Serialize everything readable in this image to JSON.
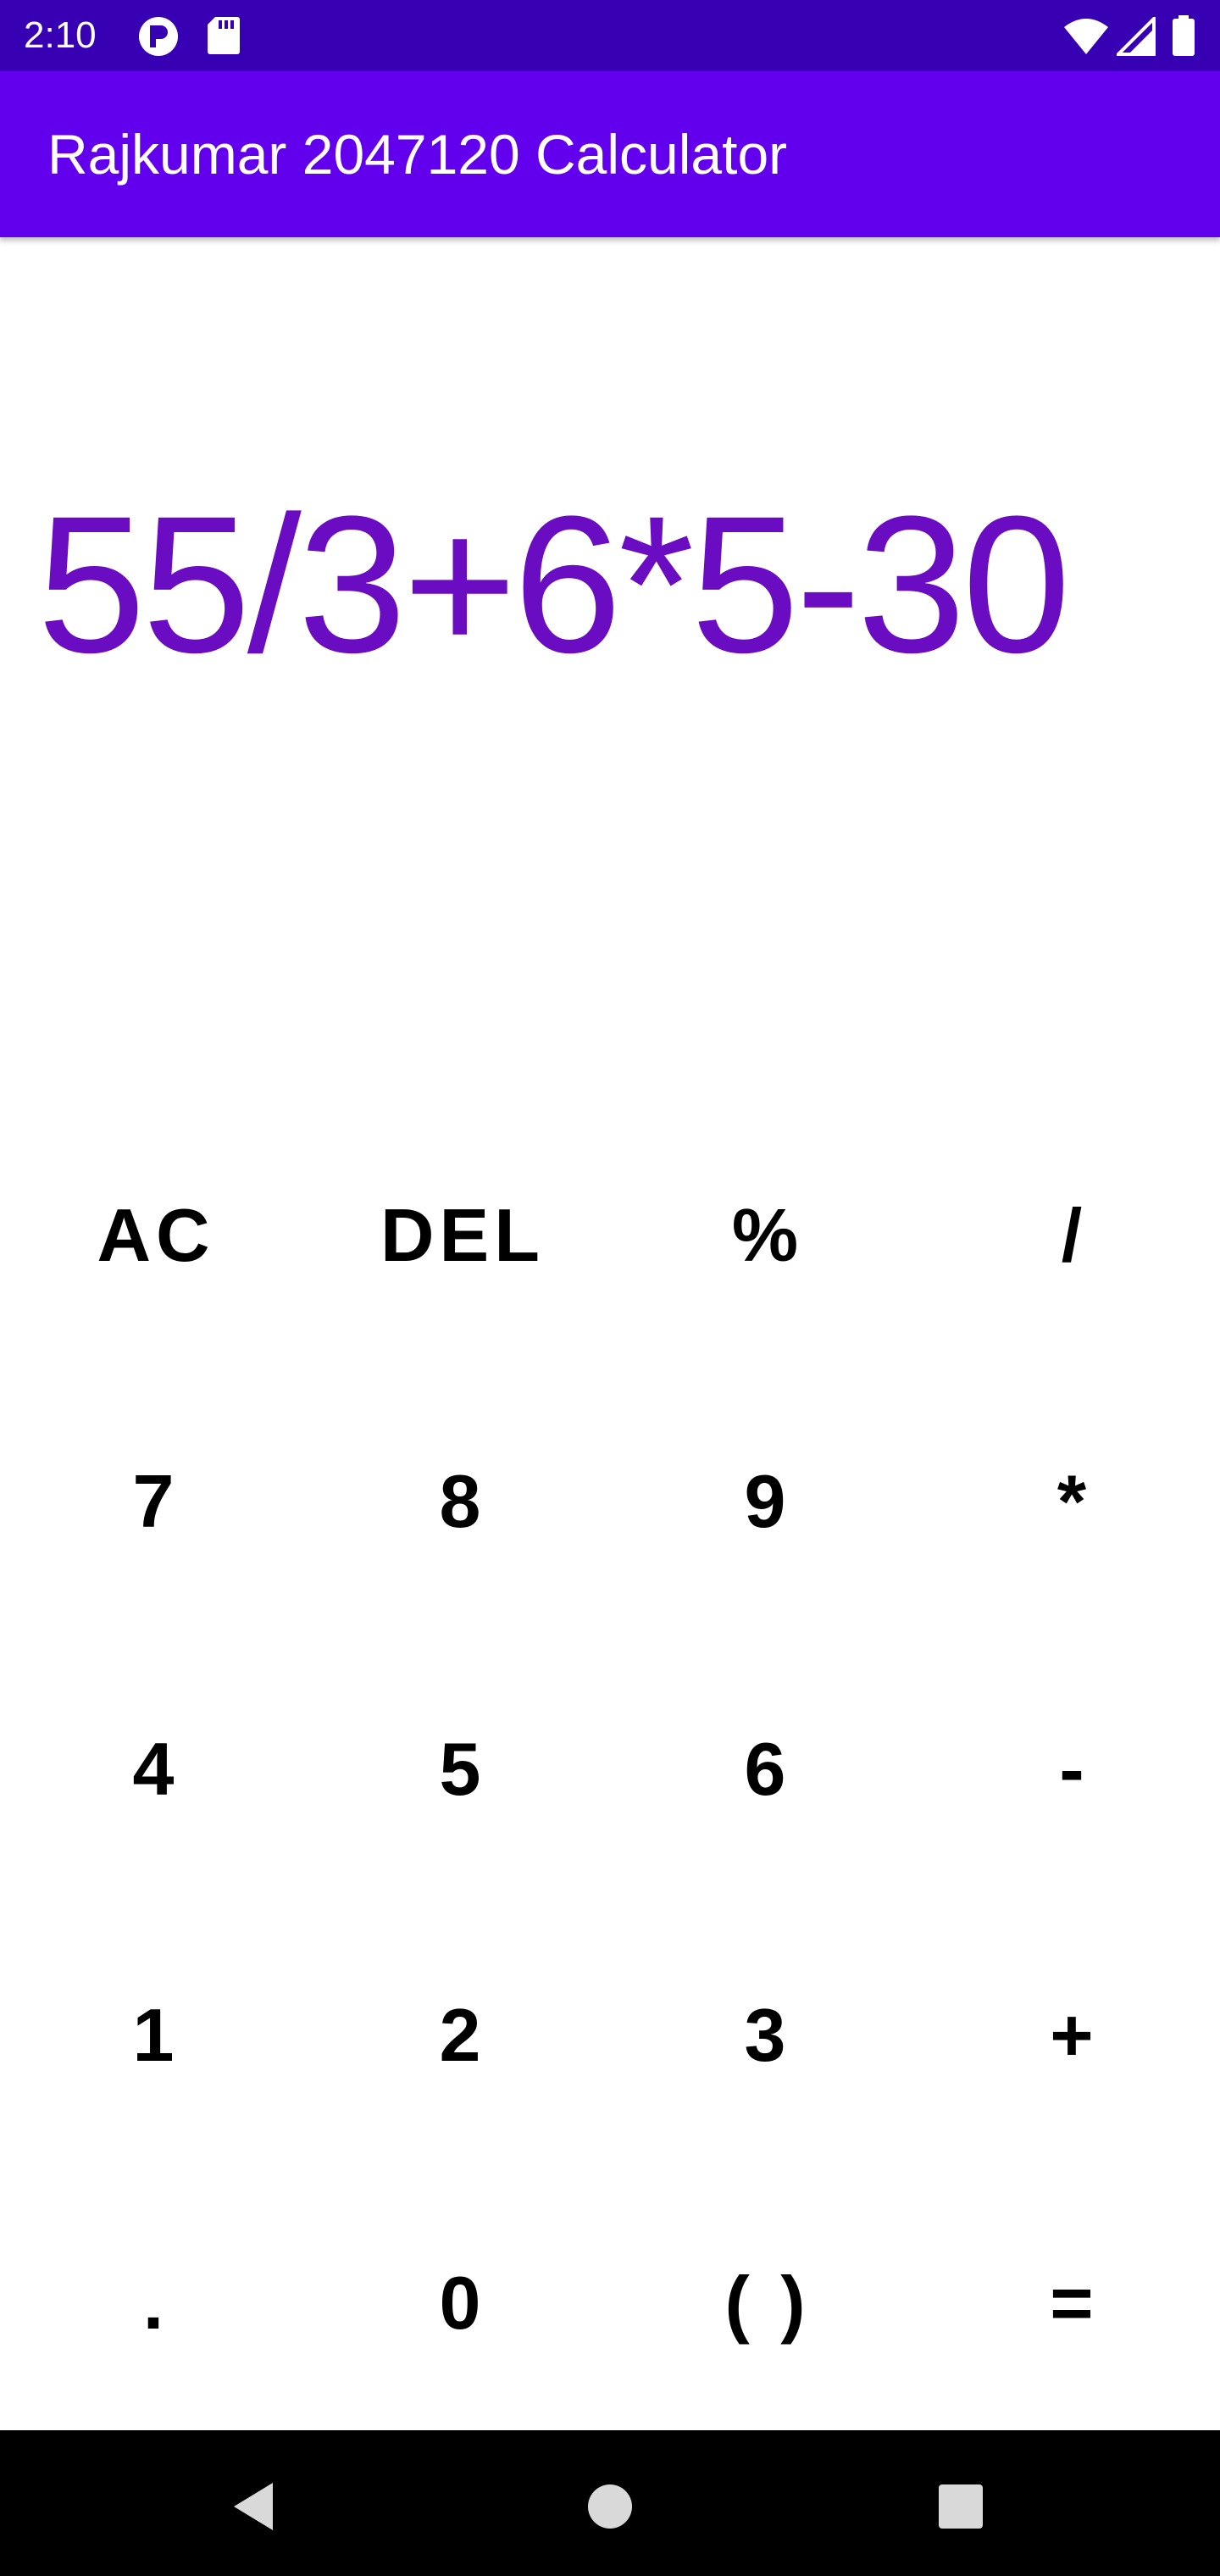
{
  "status_bar": {
    "time": "2:10",
    "icons_left": [
      "p-badge-icon",
      "sd-card-icon"
    ],
    "icons_right": [
      "wifi-icon",
      "signal-icon",
      "battery-icon"
    ],
    "background": "#3700b3"
  },
  "app_bar": {
    "title": "Rajkumar 2047120 Calculator",
    "background": "#6200ee"
  },
  "display": {
    "expression": "55/3+6*5-30",
    "color": "#6a0dc2"
  },
  "keypad": {
    "rows": [
      [
        "AC",
        "DEL",
        "%",
        "/"
      ],
      [
        "7",
        "8",
        "9",
        "*"
      ],
      [
        "4",
        "5",
        "6",
        "-"
      ],
      [
        "1",
        "2",
        "3",
        "+"
      ],
      [
        ".",
        "0",
        "( )",
        "="
      ]
    ]
  },
  "nav_bar": {
    "buttons": [
      "back-icon",
      "home-icon",
      "recents-icon"
    ]
  }
}
